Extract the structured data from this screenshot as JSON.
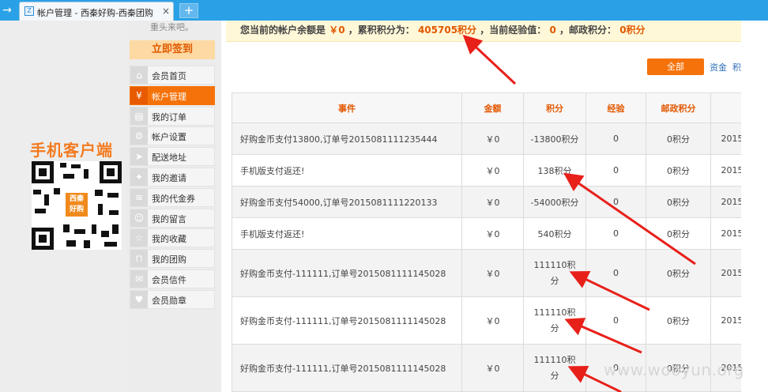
{
  "browser": {
    "tab_title": "帐户管理 - 西秦好购-西秦团购",
    "tab_close": "×",
    "new_tab": "+",
    "nav_arrow": "→",
    "favicon_glyph": "Z"
  },
  "sidebar": {
    "note": "重头来吧。",
    "signin_label": "立即签到",
    "mobile_label": "手机客户端",
    "qr_logo_line1": "西秦",
    "qr_logo_line2": "好购",
    "items": [
      {
        "label": "会员首页",
        "icon": "home-icon",
        "glyph": "⌂",
        "active": false
      },
      {
        "label": "帐户管理",
        "icon": "yen-icon",
        "glyph": "¥",
        "active": true
      },
      {
        "label": "我的订单",
        "icon": "document-icon",
        "glyph": "▤",
        "active": false
      },
      {
        "label": "帐户设置",
        "icon": "gear-icon",
        "glyph": "⚙",
        "active": false
      },
      {
        "label": "配送地址",
        "icon": "truck-icon",
        "glyph": "➤",
        "active": false
      },
      {
        "label": "我的邀请",
        "icon": "person-run-icon",
        "glyph": "✦",
        "active": false
      },
      {
        "label": "我的代金券",
        "icon": "layers-icon",
        "glyph": "≋",
        "active": false
      },
      {
        "label": "我的留言",
        "icon": "users-icon",
        "glyph": "☺",
        "active": false
      },
      {
        "label": "我的收藏",
        "icon": "star-icon",
        "glyph": "☆",
        "active": false
      },
      {
        "label": "我的团购",
        "icon": "cart-icon",
        "glyph": "⊓",
        "active": false
      },
      {
        "label": "会员信件",
        "icon": "mail-icon",
        "glyph": "✉",
        "active": false
      },
      {
        "label": "会员勋章",
        "icon": "heart-icon",
        "glyph": "♥",
        "active": false
      }
    ]
  },
  "account": {
    "balance_prefix": "您当前的帐户余额是",
    "balance": "￥0",
    "points_prefix": "，累积积分为：",
    "points": "405705积分",
    "exp_prefix": "，当前经验值：",
    "exp": "0",
    "postal_prefix": "，邮政积分：",
    "postal": "0积分"
  },
  "filters": {
    "all": "全部",
    "funds": "资金",
    "points": "积"
  },
  "table": {
    "headers": [
      "事件",
      "金额",
      "积分",
      "经验",
      "邮政积分",
      ""
    ],
    "rows": [
      {
        "event": "好购金币支付13800,订单号2015081111235444",
        "amount": "￥0",
        "points": "-13800积分",
        "exp": "0",
        "postal": "0积分",
        "date": "2015"
      },
      {
        "event": "手机版支付返还!",
        "amount": "￥0",
        "points": "138积分",
        "exp": "0",
        "postal": "0积分",
        "date": "2015"
      },
      {
        "event": "好购金币支付54000,订单号2015081111220133",
        "amount": "￥0",
        "points": "-54000积分",
        "exp": "0",
        "postal": "0积分",
        "date": "2015"
      },
      {
        "event": "手机版支付返还!",
        "amount": "￥0",
        "points": "540积分",
        "exp": "0",
        "postal": "0积分",
        "date": "2015"
      },
      {
        "event": "好购金币支付-111111,订单号2015081111145028",
        "amount": "￥0",
        "points_line1": "111110积",
        "points_line2": "分",
        "exp": "0",
        "postal": "0积分",
        "date": "2015"
      },
      {
        "event": "好购金币支付-111111,订单号2015081111145028",
        "amount": "￥0",
        "points_line1": "111110积",
        "points_line2": "分",
        "exp": "0",
        "postal": "0积分",
        "date": "2015"
      },
      {
        "event": "好购金币支付-111111,订单号2015081111145028",
        "amount": "￥0",
        "points_line1": "111110积",
        "points_line2": "分",
        "exp": "0",
        "postal": "0积分",
        "date": "2015"
      }
    ]
  },
  "watermark": "www.wooyun.org",
  "colors": {
    "tabbar": "#2aa1e6",
    "accent": "#f5720a",
    "value_highlight": "#e25800",
    "annotation_arrow": "#e8201a"
  }
}
